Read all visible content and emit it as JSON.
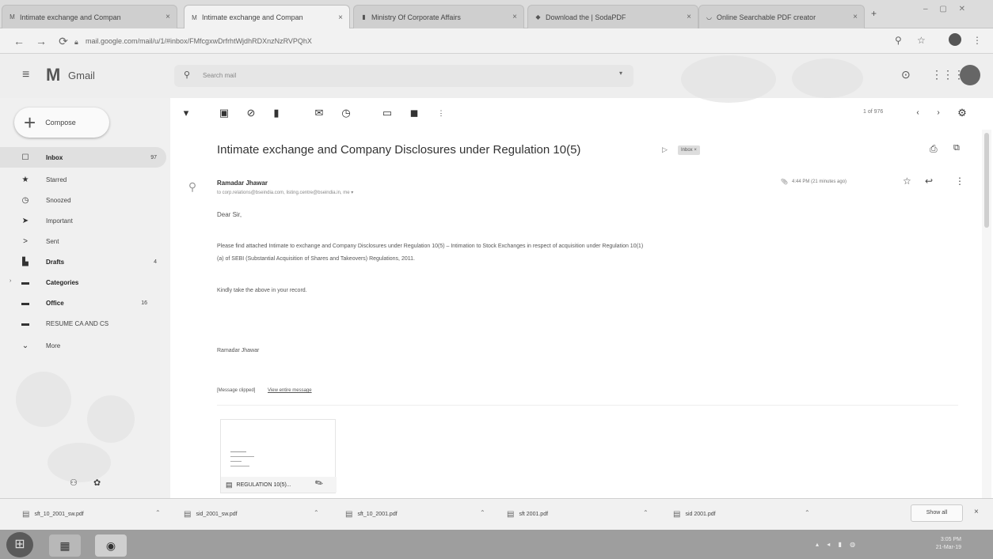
{
  "browser": {
    "tabs": [
      {
        "label": "Intimate exchange and Compan",
        "favicon": "gmail-icon",
        "active": false
      },
      {
        "label": "Intimate exchange and Compan",
        "favicon": "gmail-icon",
        "active": true
      },
      {
        "label": "Ministry Of Corporate Affairs",
        "favicon": "doc-icon",
        "active": false
      },
      {
        "label": "Download the | SodaPDF",
        "favicon": "pdf-icon",
        "active": false
      },
      {
        "label": "Online Searchable PDF creator",
        "favicon": "web-icon",
        "active": false
      }
    ],
    "new_tab": "+",
    "url": "mail.google.com/mail/u/1/#inbox/FMfcgxwDrfrhtWjdhRDXnzNzRVPQhX"
  },
  "gmail": {
    "logo_text": "Gmail",
    "search_placeholder": "Search mail",
    "compose_label": "Compose",
    "nav": [
      {
        "label": "Inbox",
        "count": "97",
        "icon": "inbox-icon",
        "bold": true
      },
      {
        "label": "Starred",
        "count": "",
        "icon": "star-icon",
        "bold": false
      },
      {
        "label": "Snoozed",
        "count": "",
        "icon": "clock-icon",
        "bold": false
      },
      {
        "label": "Important",
        "count": "",
        "icon": "important-icon",
        "bold": false
      },
      {
        "label": "Sent",
        "count": "",
        "icon": "send-icon",
        "bold": false
      },
      {
        "label": "Drafts",
        "count": "4",
        "icon": "draft-icon",
        "bold": true
      },
      {
        "label": "Categories",
        "count": "",
        "icon": "label-icon",
        "bold": true
      },
      {
        "label": "Office",
        "count": "16",
        "icon": "label-icon",
        "bold": true
      },
      {
        "label": "RESUME CA AND CS",
        "count": "",
        "icon": "label-icon",
        "bold": false
      },
      {
        "label": "More",
        "count": "",
        "icon": "chevron-down-icon",
        "bold": false
      }
    ],
    "pagination": "1 of 976"
  },
  "email": {
    "subject": "Intimate exchange and Company Disclosures under Regulation 10(5)",
    "label_badge": "Inbox ×",
    "sender": "Ramadar Jhawar",
    "recipients": "to corp.relations@bseindia.com, listing.centre@bseindia.in, me ▾",
    "timestamp": "4:44 PM (21 minutes ago)",
    "greeting": "Dear Sir,",
    "body_line1": "Please find attached Intimate to exchange and Company Disclosures under Regulation 10(5) – Intimation to Stock Exchanges in respect of acquisition under Regulation 10(1)",
    "body_line2": "(a) of SEBI (Substantial Acquisition of Shares and Takeovers) Regulations, 2011.",
    "closing": "Kindly take the above in your record.",
    "signature": "Ramadar Jhawar",
    "clipped": "[Message clipped]",
    "view_entire": "View entire message",
    "attachment_name": "REGULATION 10(5)..."
  },
  "downloads": {
    "files": [
      "sft_10_2001_sw.pdf",
      "sid_2001_sw.pdf",
      "sft_10_2001.pdf",
      "sft 2001.pdf",
      "sid 2001.pdf"
    ],
    "show_all": "Show all"
  },
  "taskbar": {
    "time": "3:05 PM",
    "date": "21-Mar-19"
  }
}
